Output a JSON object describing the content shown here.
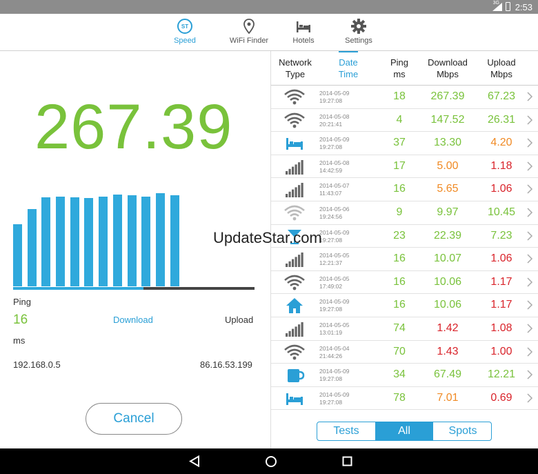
{
  "status_bar": {
    "time": "2:53",
    "network": "3G"
  },
  "top_nav": {
    "items": [
      {
        "label": "Speed",
        "icon": "speedtest-logo-icon",
        "active": true
      },
      {
        "label": "WiFi Finder",
        "icon": "location-pin-icon",
        "active": false
      },
      {
        "label": "Hotels",
        "icon": "bed-icon",
        "active": false
      },
      {
        "label": "Settings",
        "icon": "gear-icon",
        "active": false
      }
    ]
  },
  "speed": {
    "value": "267.39",
    "ping_label": "Ping",
    "ping_value": "16",
    "ping_unit": "ms",
    "download_label": "Download",
    "upload_label": "Upload",
    "local_ip": "192.168.0.5",
    "server_ip": "86.16.53.199",
    "cancel_label": "Cancel",
    "progress_fraction": 0.54,
    "bar_levels": [
      0.62,
      0.77,
      0.89,
      0.9,
      0.89,
      0.88,
      0.9,
      0.92,
      0.91,
      0.9,
      0.93,
      0.91
    ]
  },
  "table": {
    "headers": {
      "network": [
        "Network",
        "Type"
      ],
      "datetime": [
        "Date",
        "Time"
      ],
      "ping": [
        "Ping",
        "ms"
      ],
      "download": [
        "Download",
        "Mbps"
      ],
      "upload": [
        "Upload",
        "Mbps"
      ]
    },
    "rows": [
      {
        "icon": "wifi-icon",
        "date": "2014-05-09",
        "time": "19:27:08",
        "ping": "18",
        "download": "267.39",
        "upload": "67.23",
        "dl_color": "#79c23b",
        "ul_color": "#79c23b"
      },
      {
        "icon": "wifi-icon",
        "date": "2014-05-08",
        "time": "20:21:41",
        "ping": "4",
        "download": "147.52",
        "upload": "26.31",
        "dl_color": "#79c23b",
        "ul_color": "#79c23b"
      },
      {
        "icon": "bed-icon",
        "date": "2014-05-09",
        "time": "19:27:08",
        "ping": "37",
        "download": "13.30",
        "upload": "4.20",
        "dl_color": "#79c23b",
        "ul_color": "#f08a24"
      },
      {
        "icon": "cell-signal-icon",
        "date": "2014-05-08",
        "time": "14:42:59",
        "ping": "17",
        "download": "5.00",
        "upload": "1.18",
        "dl_color": "#f08a24",
        "ul_color": "#d9232a"
      },
      {
        "icon": "cell-signal-icon",
        "date": "2014-05-07",
        "time": "11:43:07",
        "ping": "16",
        "download": "5.65",
        "upload": "1.06",
        "dl_color": "#f08a24",
        "ul_color": "#d9232a"
      },
      {
        "icon": "wifi-icon",
        "date": "2014-05-06",
        "time": "19:24:56",
        "ping": "9",
        "download": "9.97",
        "upload": "10.45",
        "dl_color": "#79c23b",
        "ul_color": "#79c23b"
      },
      {
        "icon": "cocktail-icon",
        "date": "2014-05-09",
        "time": "19:27:08",
        "ping": "23",
        "download": "22.39",
        "upload": "7.23",
        "dl_color": "#79c23b",
        "ul_color": "#79c23b"
      },
      {
        "icon": "cell-signal-icon",
        "date": "2014-05-05",
        "time": "12:21:37",
        "ping": "16",
        "download": "10.07",
        "upload": "1.06",
        "dl_color": "#79c23b",
        "ul_color": "#d9232a"
      },
      {
        "icon": "wifi-icon",
        "date": "2014-05-05",
        "time": "17:49:02",
        "ping": "16",
        "download": "10.06",
        "upload": "1.17",
        "dl_color": "#79c23b",
        "ul_color": "#d9232a"
      },
      {
        "icon": "home-icon",
        "date": "2014-05-09",
        "time": "19:27:08",
        "ping": "16",
        "download": "10.06",
        "upload": "1.17",
        "dl_color": "#79c23b",
        "ul_color": "#d9232a"
      },
      {
        "icon": "cell-signal-icon",
        "date": "2014-05-05",
        "time": "13:01:19",
        "ping": "74",
        "download": "1.42",
        "upload": "1.08",
        "dl_color": "#d9232a",
        "ul_color": "#d9232a"
      },
      {
        "icon": "wifi-icon",
        "date": "2014-05-04",
        "time": "21:44:26",
        "ping": "70",
        "download": "1.43",
        "upload": "1.00",
        "dl_color": "#d9232a",
        "ul_color": "#d9232a"
      },
      {
        "icon": "coffee-cup-icon",
        "date": "2014-05-09",
        "time": "19:27:08",
        "ping": "34",
        "download": "67.49",
        "upload": "12.21",
        "dl_color": "#79c23b",
        "ul_color": "#79c23b"
      },
      {
        "icon": "bed-icon",
        "date": "2014-05-09",
        "time": "19:27:08",
        "ping": "78",
        "download": "7.01",
        "upload": "0.69",
        "dl_color": "#f08a24",
        "ul_color": "#d9232a"
      }
    ]
  },
  "filter": {
    "tests": "Tests",
    "all": "All",
    "spots": "Spots",
    "selected": "All"
  },
  "watermark": "UpdateStar.com",
  "colors": {
    "accent": "#2a9fd6",
    "good": "#79c23b",
    "medium": "#f08a24",
    "bad": "#d9232a"
  }
}
